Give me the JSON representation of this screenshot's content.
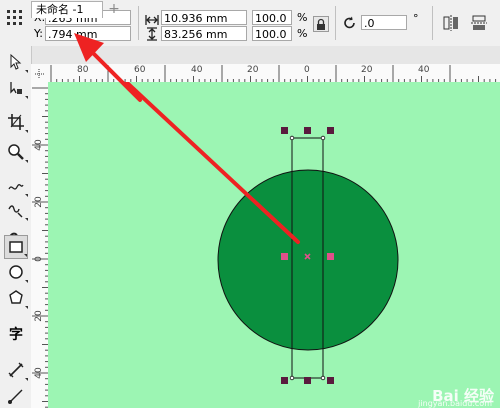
{
  "property_bar": {
    "x_label": "X:",
    "x_value": ".263 mm",
    "y_label": "Y:",
    "y_value": ".794 mm",
    "width_value": "10.936 mm",
    "height_value": "83.256 mm",
    "scale_x_value": "100.0",
    "scale_y_value": "100.0",
    "percent_x": "%",
    "percent_y": "%",
    "rotation_value": ".0",
    "degree_symbol": "°"
  },
  "tabs": {
    "document_tab": "未命名 -1",
    "add_tab": "+"
  },
  "ruler": {
    "horizontal_labels": [
      "80",
      "60",
      "40",
      "20",
      "0",
      "20",
      "40"
    ],
    "vertical_labels": [
      "40",
      "20",
      "0",
      "20",
      "40"
    ]
  },
  "tools": [
    "pick-tool",
    "shape-tool",
    "crop-tool",
    "zoom-tool",
    "freehand-tool",
    "smart-drawing-tool",
    "artistic-media-tool",
    "rectangle-tool",
    "ellipse-tool",
    "polygon-tool",
    "text-tool",
    "dimension-tool",
    "connector-tool"
  ],
  "toolbox": {
    "text_tool_glyph": "字"
  },
  "canvas": {
    "background_color": "#9cf5b3",
    "circle_color": "#0a8f3e",
    "handle_color": "#5a1a3e",
    "center_handle_color": "#e0508a",
    "arrow_color": "#ee2222"
  },
  "watermark": {
    "brand": "Bai 经验",
    "url": "jingyan.baidu.com"
  }
}
